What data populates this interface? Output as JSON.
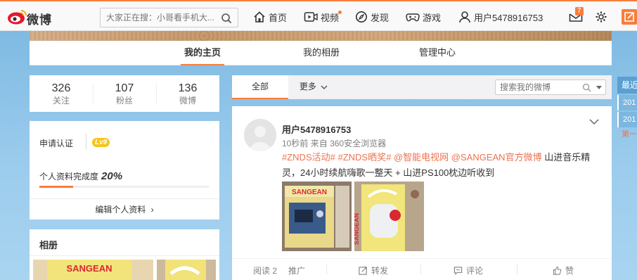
{
  "header": {
    "logo_text": "微博",
    "search_placeholder": "大家正在搜：小哥看手机大...",
    "nav": [
      {
        "label": "首页"
      },
      {
        "label": "视频"
      },
      {
        "label": "发现"
      },
      {
        "label": "游戏"
      },
      {
        "label": "用户5478916753"
      }
    ],
    "message_count": "7"
  },
  "profile_tabs": [
    {
      "label": "我的主页",
      "active": true
    },
    {
      "label": "我的相册",
      "active": false
    },
    {
      "label": "管理中心",
      "active": false
    }
  ],
  "stats": [
    {
      "value": "326",
      "label": "关注"
    },
    {
      "value": "107",
      "label": "粉丝"
    },
    {
      "value": "136",
      "label": "微博"
    }
  ],
  "profile_card": {
    "verify_label": "申请认证",
    "level": "Lv9",
    "complete_label": "个人资料完成度",
    "complete_value": "20%",
    "complete_fraction": 0.2,
    "edit_label": "编辑个人资料"
  },
  "album": {
    "title": "相册"
  },
  "feed_filter": {
    "tabs": [
      {
        "label": "全部",
        "active": true
      },
      {
        "label": "更多"
      }
    ],
    "search_placeholder": "搜索我的微博"
  },
  "post": {
    "username": "用户5478916753",
    "time": "10秒前",
    "source_prefix": "来自",
    "source": "360安全浏览器",
    "tags": [
      "#ZNDS活动#",
      "#ZNDS晒奖#",
      "@智能电视网",
      "@SANGEAN官方微博"
    ],
    "text_line1": "山进音乐精",
    "text_line2": "灵，24小时续航嗨歌一整天 + 山进PS100枕边听收到",
    "image_caption_1": "SANGEAN",
    "image_caption_2": "SANGEAN",
    "actions": {
      "read": "阅读 2",
      "promote": "推广",
      "repost": "转发",
      "comment": "评论",
      "like": "赞"
    }
  },
  "right_sidebar": {
    "title": "最近",
    "items": [
      "201",
      "201"
    ],
    "link": "第一"
  },
  "colors": {
    "accent": "#fa7d3c",
    "link": "#eb7350"
  }
}
